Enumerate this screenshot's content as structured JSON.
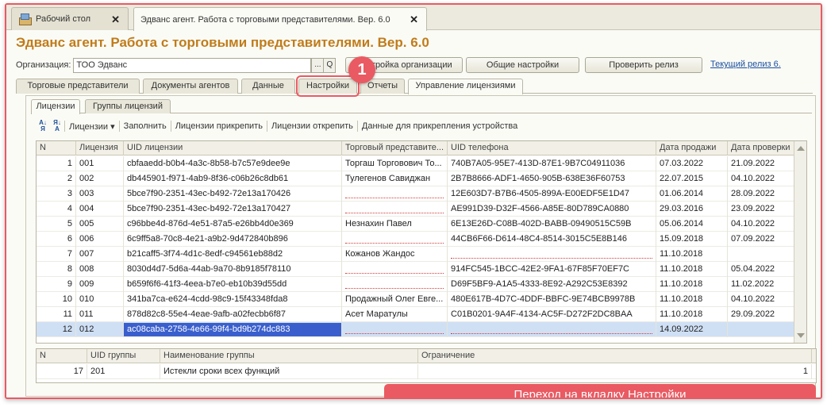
{
  "window_tabs": [
    {
      "label": "Рабочий стол"
    },
    {
      "label": "Эдванс агент. Работа с торговыми представителями. Вер. 6.0"
    }
  ],
  "title": "Эдванс агент. Работа с торговыми представителями. Вер. 6.0",
  "org": {
    "label": "Организация:",
    "value": "ТОО Эдванс",
    "btn_dots": "...",
    "btn_search": "Q"
  },
  "buttons": {
    "org_settings": "Настройка организации",
    "general_settings": "Общие настройки",
    "check_release": "Проверить релиз",
    "current_release": "Текущий релиз 6."
  },
  "main_tabs": [
    {
      "label": "Торговые представители"
    },
    {
      "label": "Документы агентов"
    },
    {
      "label": "Данные"
    },
    {
      "label": "Настройки"
    },
    {
      "label": "Отчеты"
    },
    {
      "label": "Управление лицензиями"
    }
  ],
  "sub_tabs": [
    {
      "label": "Лицензии"
    },
    {
      "label": "Группы лицензий"
    }
  ],
  "toolbar": {
    "licenses": "Лицензии",
    "fill": "Заполнить",
    "attach": "Лицензии прикрепить",
    "detach": "Лицензии открепить",
    "device_data": "Данные для прикрепления устройства"
  },
  "license_grid": {
    "headers": [
      "N",
      "Лицензия",
      "UID лицензии",
      "Торговый представите...",
      "UID телефона",
      "Дата продажи",
      "Дата проверки"
    ],
    "rows": [
      [
        "1",
        "001",
        "cbfaaedd-b0b4-4a3c-8b58-b7c57e9dee9e",
        "Торгаш Торговович То...",
        "740B7A05-95E7-413D-87E1-9B7C04911036",
        "07.03.2022",
        "21.09.2022"
      ],
      [
        "2",
        "002",
        "db445901-f971-4ab9-8f36-c06b26c8db61",
        "Тулегенов Савиджан",
        "2B7B8666-ADF1-4650-905B-638E36F60753",
        "22.07.2015",
        "04.10.2022"
      ],
      [
        "3",
        "003",
        "5bce7f90-2351-43ec-b492-72e13a170426",
        "",
        "12E603D7-B7B6-4505-899A-E00EDF5E1D47",
        "01.06.2014",
        "28.09.2022"
      ],
      [
        "4",
        "004",
        "5bce7f90-2351-43ec-b492-72e13a170427",
        "",
        "AE991D39-D32F-4566-A85E-80D789CA0880",
        "29.03.2016",
        "23.09.2022"
      ],
      [
        "5",
        "005",
        "c96bbe4d-876d-4e51-87a5-e26bb4d0e369",
        "Незнахин Павел",
        "6E13E26D-C08B-402D-BABB-09490515C59B",
        "05.06.2014",
        "04.10.2022"
      ],
      [
        "6",
        "006",
        "6c9ff5a8-70c8-4e21-a9b2-9d472840b896",
        "",
        "44CB6F66-D614-48C4-8514-3015C5E8B146",
        "15.09.2018",
        "07.09.2022"
      ],
      [
        "7",
        "007",
        "b21caff5-3f74-4d1c-8edf-c94561eb88d2",
        "Кожанов Жандос",
        "",
        "11.10.2018",
        ""
      ],
      [
        "8",
        "008",
        "8030d4d7-5d6a-44ab-9a70-8b9185f78110",
        "",
        "914FC545-1BCC-42E2-9FA1-67F85F70EF7C",
        "11.10.2018",
        "05.04.2022"
      ],
      [
        "9",
        "009",
        "b659f6f6-41f3-4eea-b7e0-eb10b39d55dd",
        "",
        "D69F5BF9-A1A5-4333-8E92-A292C53E8392",
        "11.10.2018",
        "11.02.2022"
      ],
      [
        "10",
        "010",
        "341ba7ca-e624-4cdd-98c9-15f43348fda8",
        "Продажный Олег Евге...",
        "480E617B-4D7C-4DDF-BBFC-9E74BCB9978B",
        "11.10.2018",
        "04.10.2022"
      ],
      [
        "11",
        "011",
        "878d82c8-55e4-4eae-9afb-a02fecbb6f87",
        "Асет Маратулы",
        "C01B0201-9A4F-4134-AC5F-D272F2DC8BAA",
        "11.10.2018",
        "29.09.2022"
      ],
      [
        "12",
        "012",
        "ac08caba-2758-4e66-99f4-bd9b274dc883",
        "",
        "",
        "14.09.2022",
        ""
      ]
    ]
  },
  "group_grid": {
    "headers": [
      "N",
      "UID группы",
      "Наименование группы",
      "Ограничение"
    ],
    "rows": [
      [
        "17",
        "201",
        "Истекли сроки всех функций",
        "1"
      ]
    ]
  },
  "callout": {
    "number": "1",
    "banner": "Переход на вкладку Настройки"
  },
  "colors": {
    "accent": "#ea5a62",
    "title": "#c07c1a",
    "selection": "#3a5fcd"
  }
}
